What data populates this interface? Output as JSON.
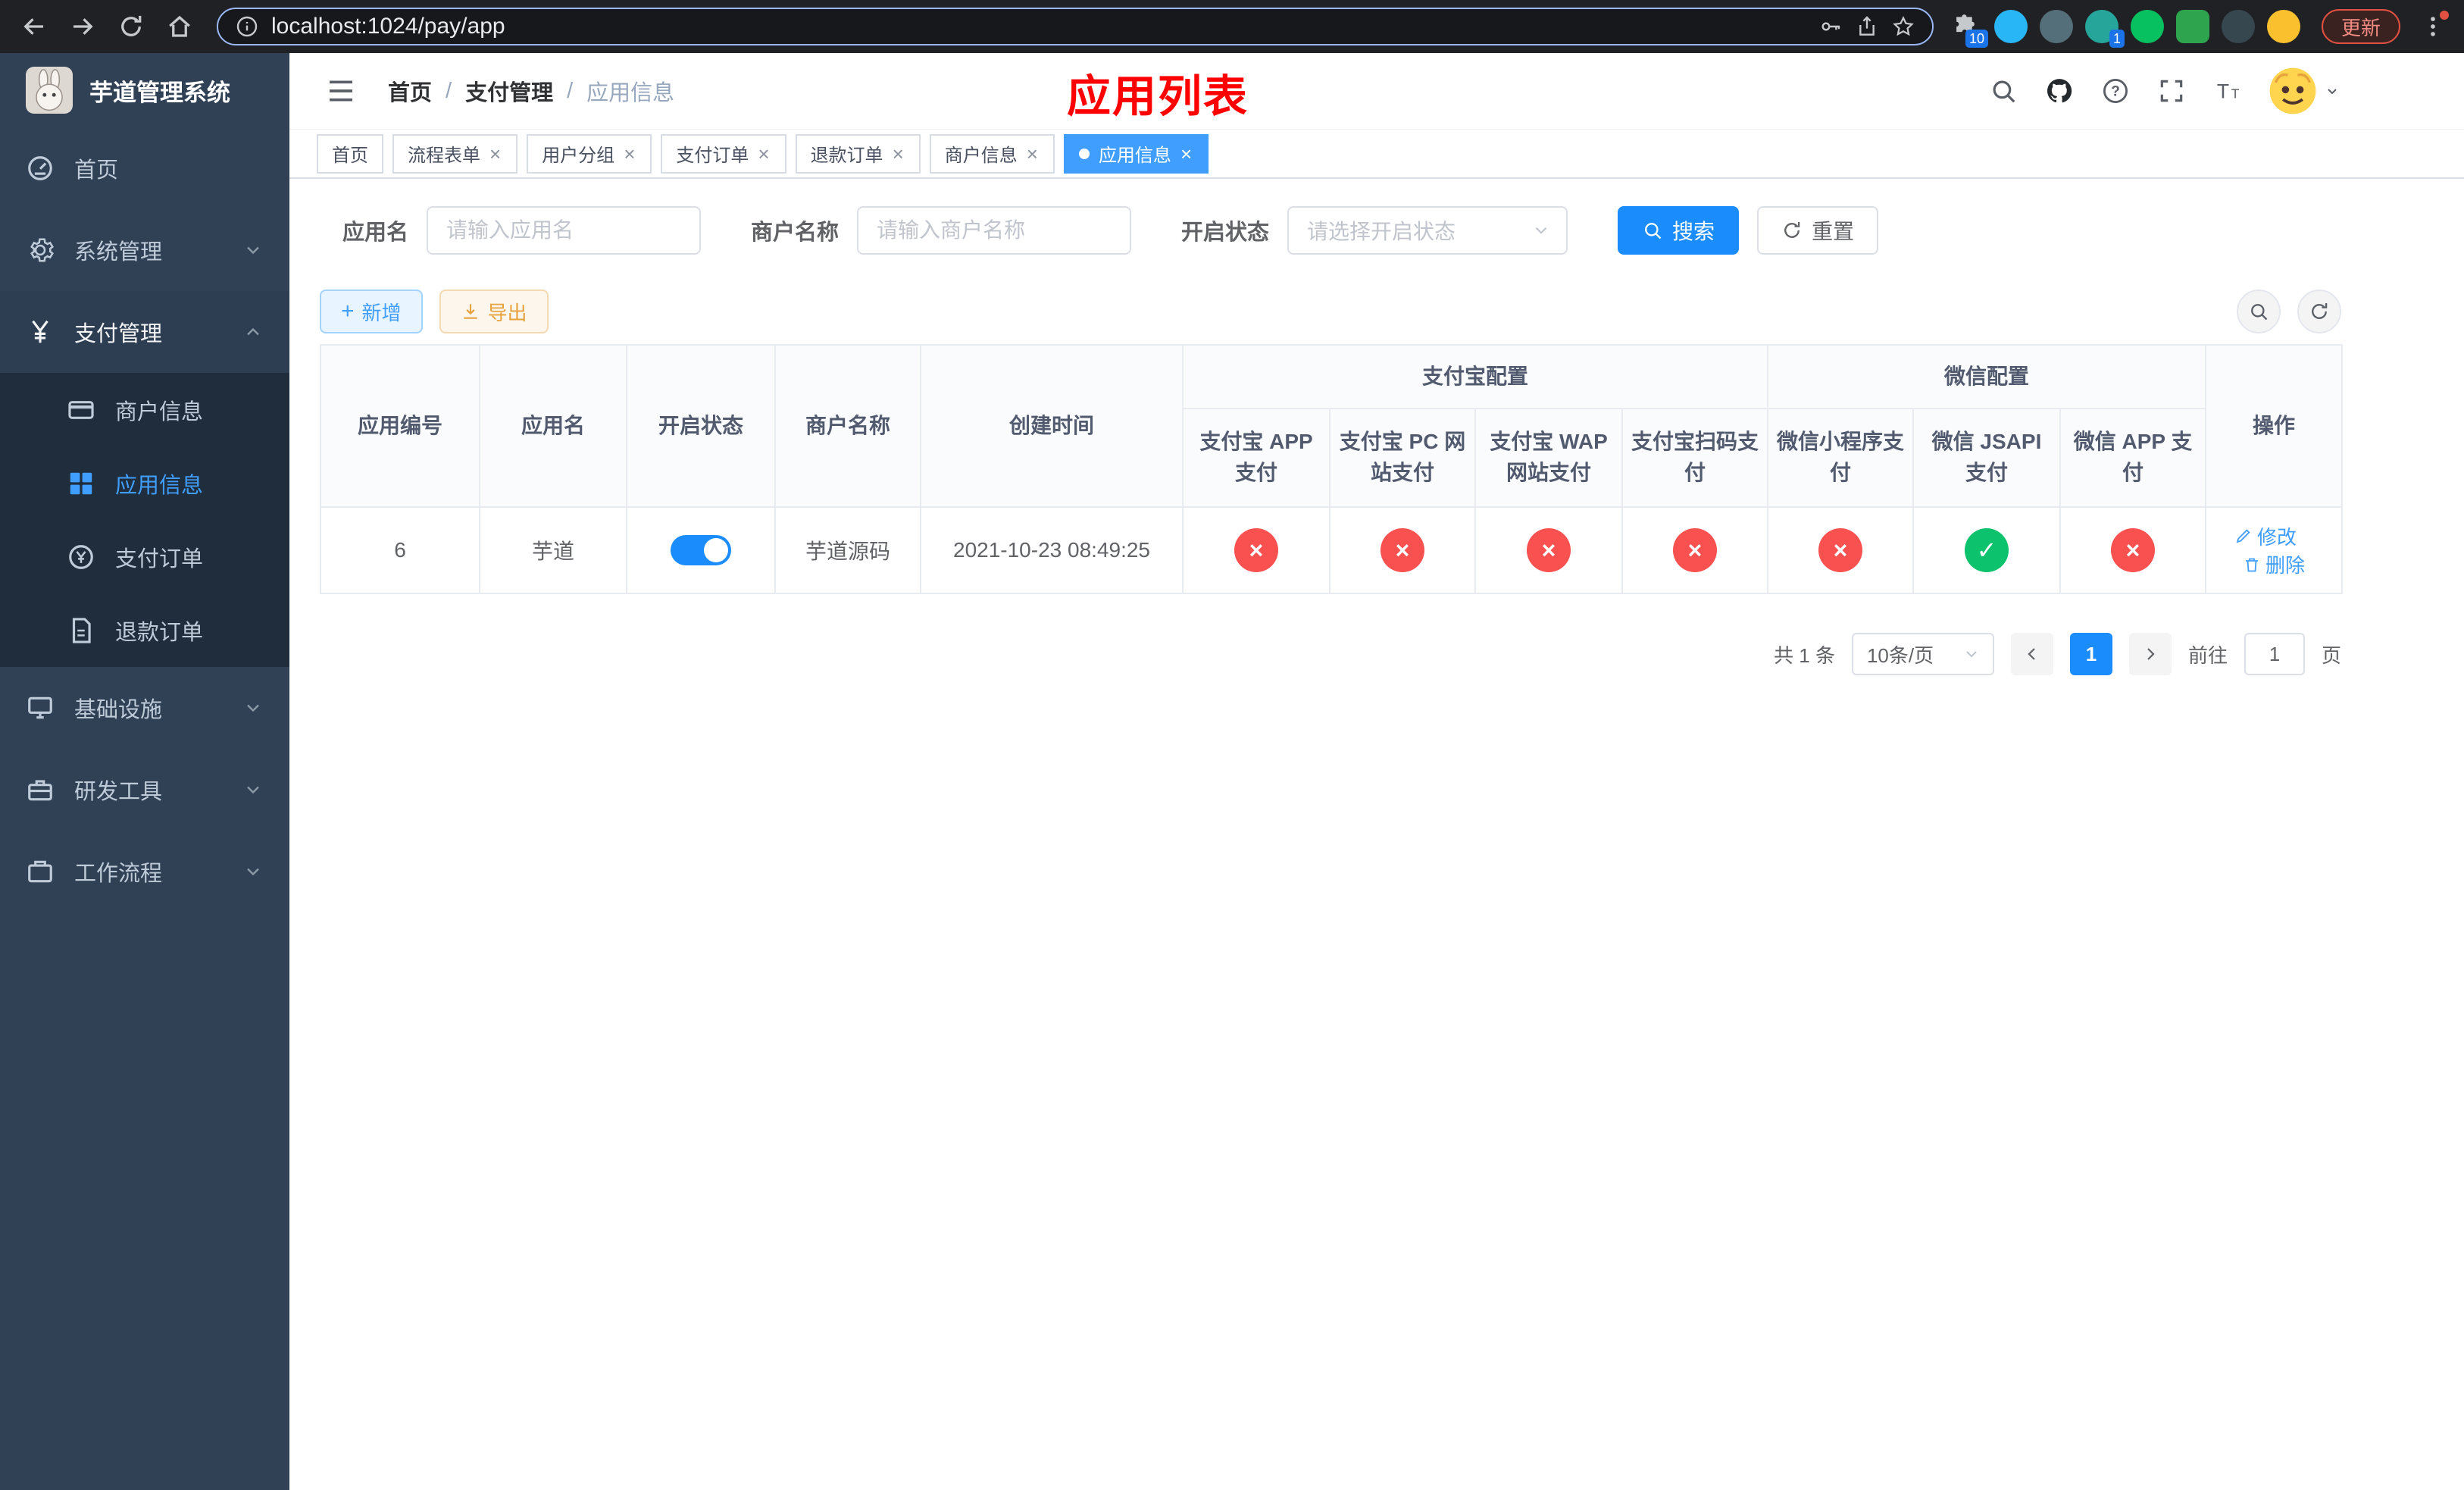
{
  "colors": {
    "accent": "#409eff",
    "danger": "#f56c6c",
    "success": "#0cc26c",
    "warning": "#e6a23c",
    "annotation": "#fe0000"
  },
  "browser": {
    "url": "localhost:1024/pay/app",
    "update_button": "更新",
    "extensions_badge": "10",
    "translate_badge": "1"
  },
  "sidebar": {
    "title": "芋道管理系统",
    "items": [
      {
        "label": "首页"
      },
      {
        "label": "系统管理"
      },
      {
        "label": "支付管理"
      },
      {
        "label": "商户信息"
      },
      {
        "label": "应用信息"
      },
      {
        "label": "支付订单"
      },
      {
        "label": "退款订单"
      },
      {
        "label": "基础设施"
      },
      {
        "label": "研发工具"
      },
      {
        "label": "工作流程"
      }
    ]
  },
  "header": {
    "breadcrumb": {
      "home": "首页",
      "section": "支付管理",
      "page": "应用信息"
    },
    "annotation": "应用列表"
  },
  "tabs": [
    {
      "label": "首页",
      "closable": false,
      "active": false
    },
    {
      "label": "流程表单",
      "closable": true,
      "active": false
    },
    {
      "label": "用户分组",
      "closable": true,
      "active": false
    },
    {
      "label": "支付订单",
      "closable": true,
      "active": false
    },
    {
      "label": "退款订单",
      "closable": true,
      "active": false
    },
    {
      "label": "商户信息",
      "closable": true,
      "active": false
    },
    {
      "label": "应用信息",
      "closable": true,
      "active": true
    }
  ],
  "filters": {
    "app_name": {
      "label": "应用名",
      "placeholder": "请输入应用名"
    },
    "merchant": {
      "label": "商户名称",
      "placeholder": "请输入商户名称"
    },
    "status": {
      "label": "开启状态",
      "placeholder": "请选择开启状态"
    },
    "search": "搜索",
    "reset": "重置"
  },
  "toolbar": {
    "add": "新增",
    "export": "导出"
  },
  "table": {
    "groups": {
      "alipay": "支付宝配置",
      "wechat": "微信配置"
    },
    "columns": {
      "id": "应用编号",
      "name": "应用名",
      "status": "开启状态",
      "merchant": "商户名称",
      "created": "创建时间",
      "alipay_app": "支付宝 APP 支付",
      "alipay_pc": "支付宝 PC 网站支付",
      "alipay_wap": "支付宝 WAP 网站支付",
      "alipay_qr": "支付宝扫码支付",
      "wx_mini": "微信小程序支付",
      "wx_jsapi": "微信 JSAPI 支付",
      "wx_app": "微信 APP 支付",
      "ops": "操作"
    },
    "rows": [
      {
        "id": "6",
        "name": "芋道",
        "enabled": true,
        "merchant": "芋道源码",
        "created": "2021-10-23 08:49:25",
        "alipay_app": false,
        "alipay_pc": false,
        "alipay_wap": false,
        "alipay_qr": false,
        "wx_mini": false,
        "wx_jsapi": true,
        "wx_app": false,
        "edit": "修改",
        "remove": "删除"
      }
    ]
  },
  "pagination": {
    "total": "共 1 条",
    "page_size": "10条/页",
    "page": "1",
    "goto_label": "前往",
    "goto_value": "1",
    "goto_unit": "页"
  }
}
